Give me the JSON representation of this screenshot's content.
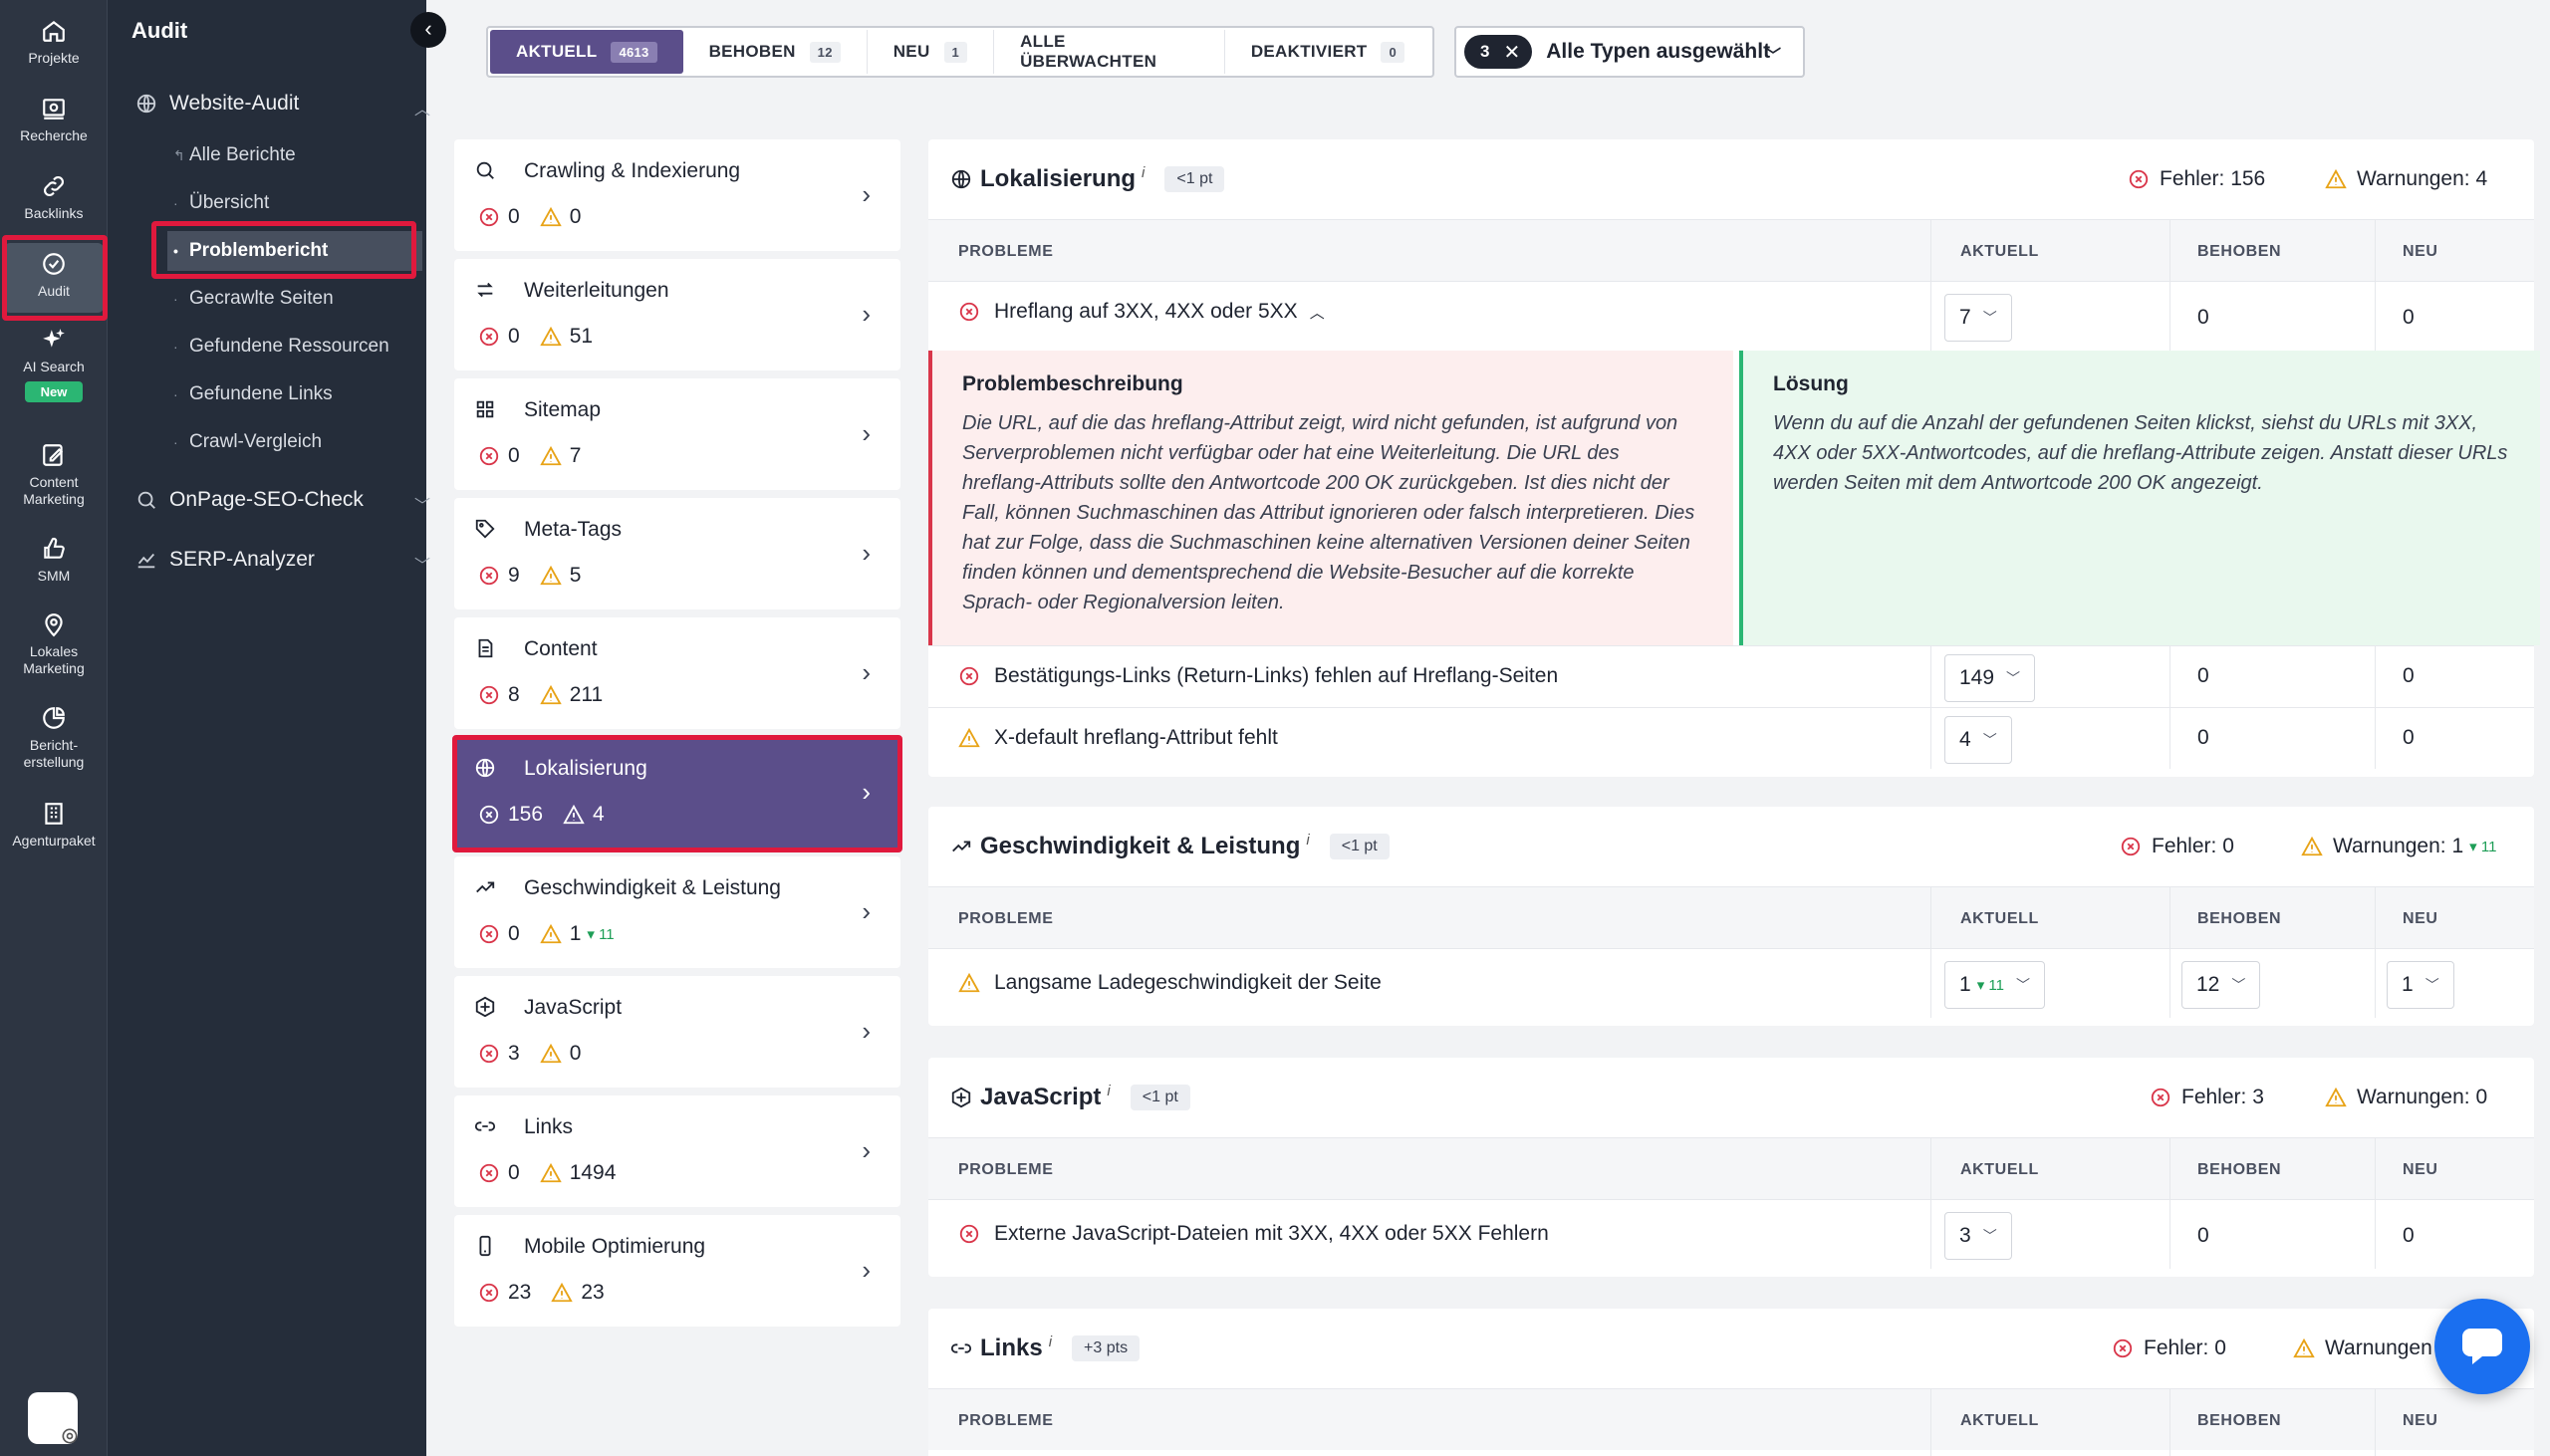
{
  "rail": [
    {
      "label": "Projekte",
      "icon": "home-icon"
    },
    {
      "label": "Recherche",
      "icon": "research-icon"
    },
    {
      "label": "Backlinks",
      "icon": "link-icon"
    },
    {
      "label": "Audit",
      "icon": "audit-check-icon"
    },
    {
      "label": "AI Search",
      "icon": "sparkle-icon",
      "badge": "New"
    },
    {
      "label": "Content Marketing",
      "icon": "edit-icon"
    },
    {
      "label": "SMM",
      "icon": "thumb-up-icon"
    },
    {
      "label": "Lokales Marketing",
      "icon": "location-pin-icon"
    },
    {
      "label": "Bericht-erstellung",
      "icon": "pie-chart-icon"
    },
    {
      "label": "Agenturpaket",
      "icon": "building-icon"
    }
  ],
  "sidebar": {
    "title": "Audit",
    "groups": [
      {
        "label": "Website-Audit",
        "icon": "globe-icon"
      },
      {
        "label": "OnPage-SEO-Check",
        "icon": "magnifier-icon"
      },
      {
        "label": "SERP-Analyzer",
        "icon": "chart-icon"
      }
    ],
    "items": [
      {
        "label": "Alle Berichte"
      },
      {
        "label": "Übersicht"
      },
      {
        "label": "Problembericht"
      },
      {
        "label": "Gecrawlte Seiten"
      },
      {
        "label": "Gefundene Ressourcen"
      },
      {
        "label": "Gefundene Links"
      },
      {
        "label": "Crawl-Vergleich"
      }
    ]
  },
  "tabs": [
    {
      "label": "AKTUELL",
      "count": "4613"
    },
    {
      "label": "BEHOBEN",
      "count": "12"
    },
    {
      "label": "NEU",
      "count": "1"
    },
    {
      "label": "ALLE ÜBERWACHTEN",
      "count": ""
    },
    {
      "label": "DEAKTIVIERT",
      "count": "0"
    }
  ],
  "type_filter": {
    "count": "3",
    "label": "Alle Typen ausgewählt"
  },
  "categories": [
    {
      "name": "Crawling & Indexierung",
      "icon": "search-icon",
      "errors": "0",
      "warnings": "0",
      "delta": ""
    },
    {
      "name": "Weiterleitungen",
      "icon": "redirect-icon",
      "errors": "0",
      "warnings": "51",
      "delta": ""
    },
    {
      "name": "Sitemap",
      "icon": "grid-icon",
      "errors": "0",
      "warnings": "7",
      "delta": ""
    },
    {
      "name": "Meta-Tags",
      "icon": "tag-icon",
      "errors": "9",
      "warnings": "5",
      "delta": ""
    },
    {
      "name": "Content",
      "icon": "document-icon",
      "errors": "8",
      "warnings": "211",
      "delta": ""
    },
    {
      "name": "Lokalisierung",
      "icon": "globe-icon",
      "errors": "156",
      "warnings": "4",
      "delta": ""
    },
    {
      "name": "Geschwindigkeit & Leistung",
      "icon": "trend-icon",
      "errors": "0",
      "warnings": "1",
      "delta": "11"
    },
    {
      "name": "JavaScript",
      "icon": "code-icon",
      "errors": "3",
      "warnings": "0",
      "delta": ""
    },
    {
      "name": "Links",
      "icon": "link-icon",
      "errors": "0",
      "warnings": "1494",
      "delta": ""
    },
    {
      "name": "Mobile Optimierung",
      "icon": "phone-icon",
      "errors": "23",
      "warnings": "23",
      "delta": ""
    }
  ],
  "headers": {
    "issues": "PROBLEME",
    "current": "AKTUELL",
    "fixed": "BEHOBEN",
    "new": "NEU"
  },
  "sections": {
    "loc": {
      "title": "Lokalisierung",
      "info": "i",
      "pts": "<1 pt",
      "errors_label": "Fehler: 156",
      "warnings_label": "Warnungen: 4",
      "rows": [
        {
          "issue": "Hreflang auf 3XX, 4XX oder 5XX",
          "current": "7",
          "fixed": "0",
          "new": "0"
        },
        {
          "issue": "Bestätigungs-Links (Return-Links) fehlen auf Hreflang-Seiten",
          "current": "149",
          "fixed": "0",
          "new": "0"
        },
        {
          "issue": "X-default hreflang-Attribut fehlt",
          "current": "4",
          "fixed": "0",
          "new": "0"
        }
      ],
      "problem_title": "Problembeschreibung",
      "problem_text": "Die URL, auf die das hreflang-Attribut zeigt, wird nicht gefunden, ist aufgrund von Serverproblemen nicht verfügbar oder hat eine Weiterleitung. Die URL des hreflang-Attributs sollte den Antwortcode 200 OK zurückgeben. Ist dies nicht der Fall, können Suchmaschinen das Attribut ignorieren oder falsch interpretieren. Dies hat zur Folge, dass die Suchmaschinen keine alternativen Versionen deiner Seiten finden können und dementsprechend die Website-Besucher auf die korrekte Sprach- oder Regionalversion leiten.",
      "solution_title": "Lösung",
      "solution_text": "Wenn du auf die Anzahl der gefundenen Seiten klickst, siehst du URLs mit 3XX, 4XX oder 5XX-Antwortcodes, auf die hreflang-Attribute zeigen. Anstatt dieser URLs werden Seiten mit dem Antwortcode 200 OK angezeigt."
    },
    "speed": {
      "title": "Geschwindigkeit & Leistung",
      "info": "i",
      "pts": "<1 pt",
      "errors_label": "Fehler: 0",
      "warnings_label": "Warnungen: 1",
      "warnings_delta": "11",
      "rows": [
        {
          "issue": "Langsame Ladegeschwindigkeit der Seite",
          "current": "1",
          "current_delta": "11",
          "fixed": "12",
          "new": "1"
        }
      ]
    },
    "js": {
      "title": "JavaScript",
      "info": "i",
      "pts": "<1 pt",
      "errors_label": "Fehler: 3",
      "warnings_label": "Warnungen: 0",
      "rows": [
        {
          "issue": "Externe JavaScript-Dateien mit 3XX, 4XX oder 5XX Fehlern",
          "current": "3",
          "fixed": "0",
          "new": "0"
        }
      ]
    },
    "links": {
      "title": "Links",
      "info": "i",
      "pts": "+3 pts",
      "errors_label": "Fehler: 0",
      "warnings_label": "Warnungen"
    }
  },
  "colors": {
    "accent": "#5b4e8a",
    "error": "#d9364a",
    "warning": "#e8a317",
    "highlight": "#e0193d",
    "sidebar": "#252d3a"
  }
}
